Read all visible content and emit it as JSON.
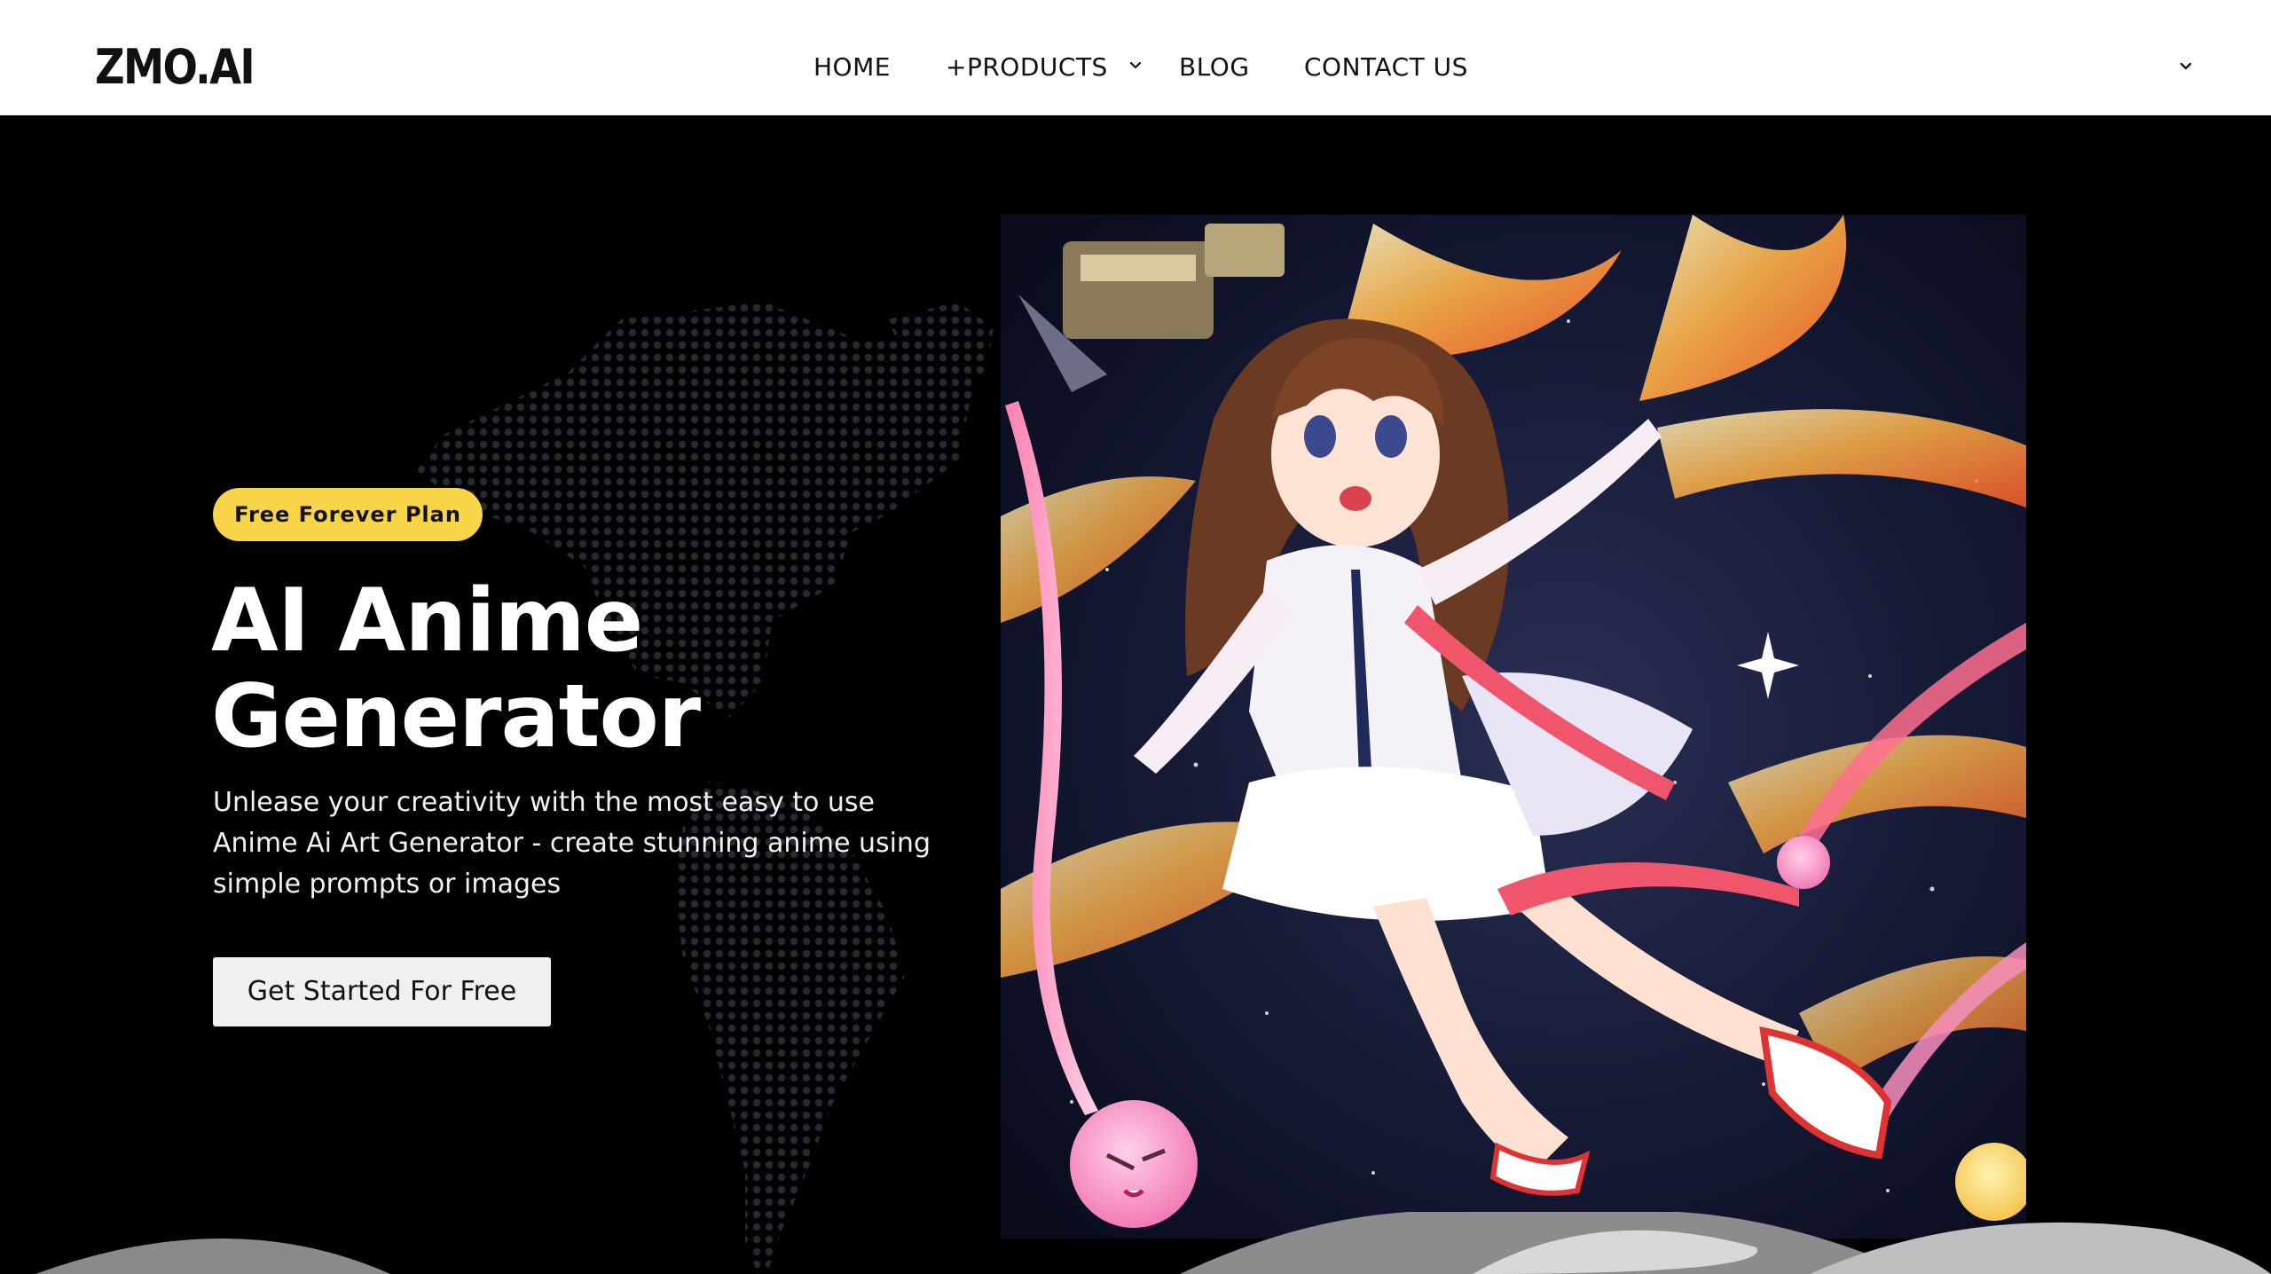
{
  "header": {
    "logo": "ZMO.AI",
    "nav": [
      {
        "label": "HOME"
      },
      {
        "label": "+PRODUCTS",
        "has_dropdown": true
      },
      {
        "label": "BLOG"
      },
      {
        "label": "CONTACT US"
      }
    ]
  },
  "hero": {
    "badge": "Free Forever Plan",
    "title_line1": "AI Anime",
    "title_line2": "Generator",
    "description": "Unlease your creativity with the most easy to use Anime Ai Art Generator - create stunning anime using simple prompts or images",
    "cta_label": "Get Started For Free"
  },
  "colors": {
    "badge_bg": "#f8d548",
    "hero_bg": "#000000",
    "header_bg": "#ffffff"
  },
  "icons": {
    "nav_dropdown": "chevron-down-icon",
    "header_menu": "chevron-down-icon"
  }
}
